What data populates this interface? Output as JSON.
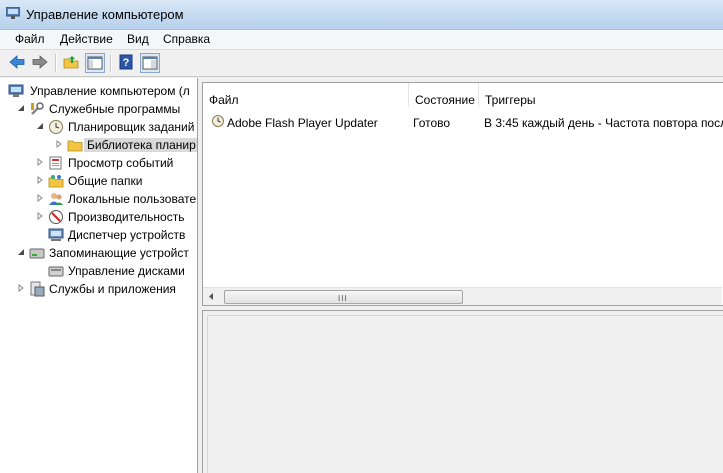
{
  "window": {
    "title": "Управление компьютером"
  },
  "menu": [
    "Файл",
    "Действие",
    "Вид",
    "Справка"
  ],
  "toolbar": {
    "buttons": [
      "back-icon",
      "forward-icon",
      "up-folder-icon",
      "show-hide-console-tree-icon",
      "help-icon",
      "show-hide-action-pane-icon"
    ]
  },
  "tree": {
    "root": "Управление компьютером (л",
    "items": [
      {
        "label": "Служебные программы",
        "icon": "tools-icon"
      },
      {
        "label": "Планировщик заданий",
        "icon": "clock-icon"
      },
      {
        "label": "Библиотека планир",
        "icon": "folder-icon"
      },
      {
        "label": "Просмотр событий",
        "icon": "event-viewer-icon"
      },
      {
        "label": "Общие папки",
        "icon": "shared-folders-icon"
      },
      {
        "label": "Локальные пользовате",
        "icon": "users-icon"
      },
      {
        "label": "Производительность",
        "icon": "performance-icon"
      },
      {
        "label": "Диспетчер устройств",
        "icon": "device-manager-icon"
      },
      {
        "label": "Запоминающие устройст",
        "icon": "storage-icon"
      },
      {
        "label": "Управление дисками",
        "icon": "disk-icon"
      },
      {
        "label": "Службы и приложения",
        "icon": "services-icon"
      }
    ]
  },
  "list": {
    "columns": [
      "Файл",
      "Состояние",
      "Триггеры"
    ],
    "rows": [
      {
        "name": "Adobe Flash Player Updater",
        "status": "Готово",
        "trigger": "В 3:45 каждый день - Частота повтора посл"
      }
    ],
    "scroll_grip": "III"
  }
}
